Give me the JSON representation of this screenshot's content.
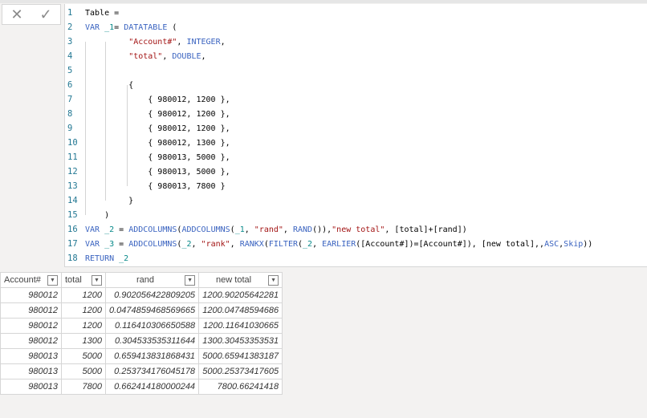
{
  "formula_bar": {
    "cancel_icon": "x-icon",
    "commit_icon": "check-icon",
    "code_lines": [
      [
        [
          "txt",
          "Table ="
        ]
      ],
      [
        [
          "kw",
          "VAR "
        ],
        [
          "var",
          "_1"
        ],
        [
          "txt",
          "= "
        ],
        [
          "kw",
          "DATATABLE"
        ],
        [
          "txt",
          " ("
        ]
      ],
      [
        [
          "txt",
          "         "
        ],
        [
          "str",
          "\"Account#\""
        ],
        [
          "txt",
          ", "
        ],
        [
          "kw",
          "INTEGER"
        ],
        [
          "txt",
          ","
        ]
      ],
      [
        [
          "txt",
          "         "
        ],
        [
          "str",
          "\"total\""
        ],
        [
          "txt",
          ", "
        ],
        [
          "kw",
          "DOUBLE"
        ],
        [
          "txt",
          ","
        ]
      ],
      [
        [
          "txt",
          ""
        ]
      ],
      [
        [
          "txt",
          "         {"
        ]
      ],
      [
        [
          "txt",
          "             { 980012, 1200 },"
        ]
      ],
      [
        [
          "txt",
          "             { 980012, 1200 },"
        ]
      ],
      [
        [
          "txt",
          "             { 980012, 1200 },"
        ]
      ],
      [
        [
          "txt",
          "             { 980012, 1300 },"
        ]
      ],
      [
        [
          "txt",
          "             { 980013, 5000 },"
        ]
      ],
      [
        [
          "txt",
          "             { 980013, 5000 },"
        ]
      ],
      [
        [
          "txt",
          "             { 980013, 7800 }"
        ]
      ],
      [
        [
          "txt",
          "         }"
        ]
      ],
      [
        [
          "txt",
          "    )"
        ]
      ],
      [
        [
          "kw",
          "VAR "
        ],
        [
          "var",
          "_2"
        ],
        [
          "txt",
          " = "
        ],
        [
          "kw",
          "ADDCOLUMNS"
        ],
        [
          "txt",
          "("
        ],
        [
          "kw",
          "ADDCOLUMNS"
        ],
        [
          "txt",
          "("
        ],
        [
          "var",
          "_1"
        ],
        [
          "txt",
          ", "
        ],
        [
          "str",
          "\"rand\""
        ],
        [
          "txt",
          ", "
        ],
        [
          "kw",
          "RAND"
        ],
        [
          "txt",
          "()),"
        ],
        [
          "str",
          "\"new total\""
        ],
        [
          "txt",
          ", [total]+[rand])"
        ]
      ],
      [
        [
          "kw",
          "VAR "
        ],
        [
          "var",
          "_3"
        ],
        [
          "txt",
          " = "
        ],
        [
          "kw",
          "ADDCOLUMNS"
        ],
        [
          "txt",
          "("
        ],
        [
          "var",
          "_2"
        ],
        [
          "txt",
          ", "
        ],
        [
          "str",
          "\"rank\""
        ],
        [
          "txt",
          ", "
        ],
        [
          "kw",
          "RANKX"
        ],
        [
          "txt",
          "("
        ],
        [
          "kw",
          "FILTER"
        ],
        [
          "txt",
          "("
        ],
        [
          "var",
          "_2"
        ],
        [
          "txt",
          ", "
        ],
        [
          "kw",
          "EARLIER"
        ],
        [
          "txt",
          "([Account#])=[Account#]), [new total],,"
        ],
        [
          "kw",
          "ASC"
        ],
        [
          "txt",
          ","
        ],
        [
          "kw",
          "Skip"
        ],
        [
          "txt",
          "))"
        ]
      ],
      [
        [
          "kw",
          "RETURN "
        ],
        [
          "var",
          "_2"
        ]
      ]
    ]
  },
  "table": {
    "columns": [
      "Account#",
      "total",
      "rand",
      "new total"
    ],
    "filter_icon": "chevron-down-icon",
    "rows": [
      [
        "980012",
        "1200",
        "0.902056422809205",
        "1200.90205642281"
      ],
      [
        "980012",
        "1200",
        "0.0474859468569665",
        "1200.04748594686"
      ],
      [
        "980012",
        "1200",
        "0.116410306650588",
        "1200.11641030665"
      ],
      [
        "980012",
        "1300",
        "0.304533535311644",
        "1300.30453353531"
      ],
      [
        "980013",
        "5000",
        "0.659413831868431",
        "5000.65941383187"
      ],
      [
        "980013",
        "5000",
        "0.253734176045178",
        "5000.25373417605"
      ],
      [
        "980013",
        "7800",
        "0.662414180000244",
        "7800.66241418"
      ]
    ]
  }
}
